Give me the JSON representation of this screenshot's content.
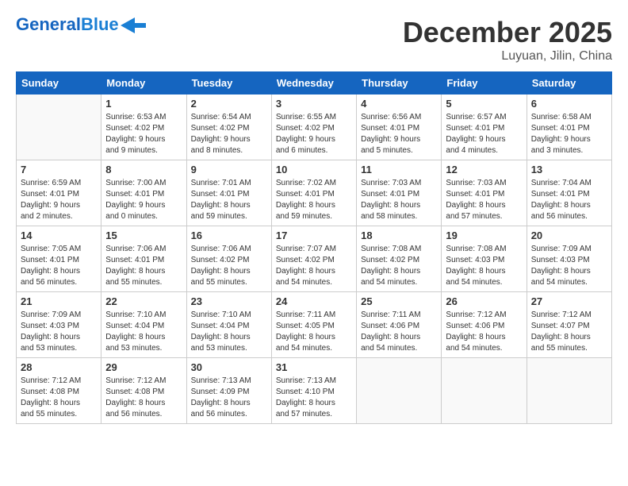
{
  "header": {
    "logo_general": "General",
    "logo_blue": "Blue",
    "month_year": "December 2025",
    "location": "Luyuan, Jilin, China"
  },
  "weekdays": [
    "Sunday",
    "Monday",
    "Tuesday",
    "Wednesday",
    "Thursday",
    "Friday",
    "Saturday"
  ],
  "weeks": [
    [
      {
        "day": "",
        "info": ""
      },
      {
        "day": "1",
        "info": "Sunrise: 6:53 AM\nSunset: 4:02 PM\nDaylight: 9 hours\nand 9 minutes."
      },
      {
        "day": "2",
        "info": "Sunrise: 6:54 AM\nSunset: 4:02 PM\nDaylight: 9 hours\nand 8 minutes."
      },
      {
        "day": "3",
        "info": "Sunrise: 6:55 AM\nSunset: 4:02 PM\nDaylight: 9 hours\nand 6 minutes."
      },
      {
        "day": "4",
        "info": "Sunrise: 6:56 AM\nSunset: 4:01 PM\nDaylight: 9 hours\nand 5 minutes."
      },
      {
        "day": "5",
        "info": "Sunrise: 6:57 AM\nSunset: 4:01 PM\nDaylight: 9 hours\nand 4 minutes."
      },
      {
        "day": "6",
        "info": "Sunrise: 6:58 AM\nSunset: 4:01 PM\nDaylight: 9 hours\nand 3 minutes."
      }
    ],
    [
      {
        "day": "7",
        "info": "Sunrise: 6:59 AM\nSunset: 4:01 PM\nDaylight: 9 hours\nand 2 minutes."
      },
      {
        "day": "8",
        "info": "Sunrise: 7:00 AM\nSunset: 4:01 PM\nDaylight: 9 hours\nand 0 minutes."
      },
      {
        "day": "9",
        "info": "Sunrise: 7:01 AM\nSunset: 4:01 PM\nDaylight: 8 hours\nand 59 minutes."
      },
      {
        "day": "10",
        "info": "Sunrise: 7:02 AM\nSunset: 4:01 PM\nDaylight: 8 hours\nand 59 minutes."
      },
      {
        "day": "11",
        "info": "Sunrise: 7:03 AM\nSunset: 4:01 PM\nDaylight: 8 hours\nand 58 minutes."
      },
      {
        "day": "12",
        "info": "Sunrise: 7:03 AM\nSunset: 4:01 PM\nDaylight: 8 hours\nand 57 minutes."
      },
      {
        "day": "13",
        "info": "Sunrise: 7:04 AM\nSunset: 4:01 PM\nDaylight: 8 hours\nand 56 minutes."
      }
    ],
    [
      {
        "day": "14",
        "info": "Sunrise: 7:05 AM\nSunset: 4:01 PM\nDaylight: 8 hours\nand 56 minutes."
      },
      {
        "day": "15",
        "info": "Sunrise: 7:06 AM\nSunset: 4:01 PM\nDaylight: 8 hours\nand 55 minutes."
      },
      {
        "day": "16",
        "info": "Sunrise: 7:06 AM\nSunset: 4:02 PM\nDaylight: 8 hours\nand 55 minutes."
      },
      {
        "day": "17",
        "info": "Sunrise: 7:07 AM\nSunset: 4:02 PM\nDaylight: 8 hours\nand 54 minutes."
      },
      {
        "day": "18",
        "info": "Sunrise: 7:08 AM\nSunset: 4:02 PM\nDaylight: 8 hours\nand 54 minutes."
      },
      {
        "day": "19",
        "info": "Sunrise: 7:08 AM\nSunset: 4:03 PM\nDaylight: 8 hours\nand 54 minutes."
      },
      {
        "day": "20",
        "info": "Sunrise: 7:09 AM\nSunset: 4:03 PM\nDaylight: 8 hours\nand 54 minutes."
      }
    ],
    [
      {
        "day": "21",
        "info": "Sunrise: 7:09 AM\nSunset: 4:03 PM\nDaylight: 8 hours\nand 53 minutes."
      },
      {
        "day": "22",
        "info": "Sunrise: 7:10 AM\nSunset: 4:04 PM\nDaylight: 8 hours\nand 53 minutes."
      },
      {
        "day": "23",
        "info": "Sunrise: 7:10 AM\nSunset: 4:04 PM\nDaylight: 8 hours\nand 53 minutes."
      },
      {
        "day": "24",
        "info": "Sunrise: 7:11 AM\nSunset: 4:05 PM\nDaylight: 8 hours\nand 54 minutes."
      },
      {
        "day": "25",
        "info": "Sunrise: 7:11 AM\nSunset: 4:06 PM\nDaylight: 8 hours\nand 54 minutes."
      },
      {
        "day": "26",
        "info": "Sunrise: 7:12 AM\nSunset: 4:06 PM\nDaylight: 8 hours\nand 54 minutes."
      },
      {
        "day": "27",
        "info": "Sunrise: 7:12 AM\nSunset: 4:07 PM\nDaylight: 8 hours\nand 55 minutes."
      }
    ],
    [
      {
        "day": "28",
        "info": "Sunrise: 7:12 AM\nSunset: 4:08 PM\nDaylight: 8 hours\nand 55 minutes."
      },
      {
        "day": "29",
        "info": "Sunrise: 7:12 AM\nSunset: 4:08 PM\nDaylight: 8 hours\nand 56 minutes."
      },
      {
        "day": "30",
        "info": "Sunrise: 7:13 AM\nSunset: 4:09 PM\nDaylight: 8 hours\nand 56 minutes."
      },
      {
        "day": "31",
        "info": "Sunrise: 7:13 AM\nSunset: 4:10 PM\nDaylight: 8 hours\nand 57 minutes."
      },
      {
        "day": "",
        "info": ""
      },
      {
        "day": "",
        "info": ""
      },
      {
        "day": "",
        "info": ""
      }
    ]
  ]
}
